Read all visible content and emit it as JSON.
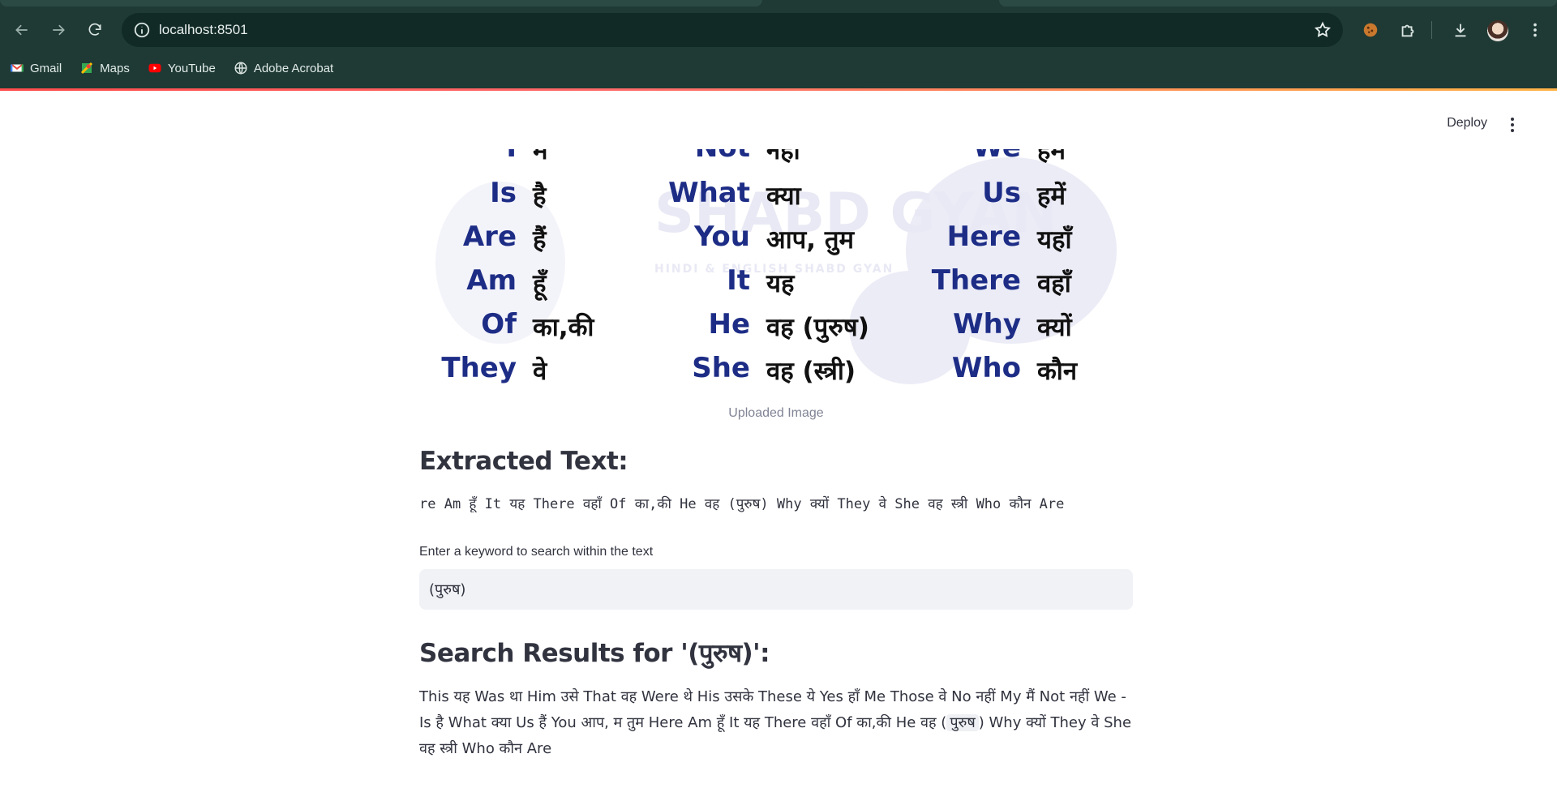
{
  "browser": {
    "url": "localhost:8501",
    "bookmarks": [
      {
        "label": "Gmail",
        "icon": "gmail-icon"
      },
      {
        "label": "Maps",
        "icon": "maps-icon"
      },
      {
        "label": "YouTube",
        "icon": "youtube-icon"
      },
      {
        "label": "Adobe Acrobat",
        "icon": "globe-icon"
      }
    ]
  },
  "app": {
    "deploy_label": "Deploy",
    "image": {
      "caption": "Uploaded Image",
      "watermark_title": "SHABD GYAN",
      "watermark_sub": "HINDI & ENGLISH SHABD GYAN",
      "rows": [
        {
          "c1_en": "I",
          "c1_hi": "मैं",
          "c2_en": "Not",
          "c2_hi": "नहीं",
          "c3_en": "We",
          "c3_hi": "हम"
        },
        {
          "c1_en": "Is",
          "c1_hi": "है",
          "c2_en": "What",
          "c2_hi": "क्या",
          "c3_en": "Us",
          "c3_hi": "हमें"
        },
        {
          "c1_en": "Are",
          "c1_hi": "हैं",
          "c2_en": "You",
          "c2_hi": "आप, तुम",
          "c3_en": "Here",
          "c3_hi": "यहाँ"
        },
        {
          "c1_en": "Am",
          "c1_hi": "हूँ",
          "c2_en": "It",
          "c2_hi": "यह",
          "c3_en": "There",
          "c3_hi": "वहाँ"
        },
        {
          "c1_en": "Of",
          "c1_hi": "का,की",
          "c2_en": "He",
          "c2_hi": "वह (पुरुष)",
          "c3_en": "Why",
          "c3_hi": "क्यों"
        },
        {
          "c1_en": "They",
          "c1_hi": "वे",
          "c2_en": "She",
          "c2_hi": "वह (स्त्री)",
          "c3_en": "Who",
          "c3_hi": "कौन"
        }
      ]
    },
    "extracted_title": "Extracted Text:",
    "extracted_text": "re  Am   हूँ It यह There वहाँ Of का,की He वह (पुरुष) Why क्यों They  वे She वह स्त्री Who कौन Are",
    "search_label": "Enter a keyword to search within the text",
    "search_value": "(पुरुष)",
    "results_title": "Search Results for '(पुरुष)':",
    "results_before": "This यह Was था Him उसे That वह Were थे His उसके These ये Yes हाँ Me Those वे No नहीं My मैं Not नहीं We - Is है What क्या Us हैं You आप, म तुम Here Am हूँ It यह There वहाँ Of का,की He वह (",
    "results_highlight": "पुरुष",
    "results_after": ") Why क्यों They वे She वह स्त्री Who कौन Are"
  }
}
